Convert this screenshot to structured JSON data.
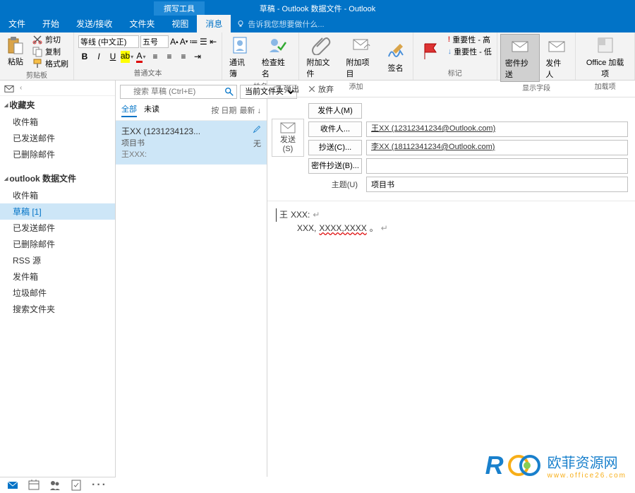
{
  "titlebar": {
    "tool": "撰写工具",
    "title": "草稿 - Outlook 数据文件 - Outlook"
  },
  "tabs": {
    "file": "文件",
    "home": "开始",
    "sendrecv": "发送/接收",
    "folder": "文件夹",
    "view": "视图",
    "message": "消息",
    "tellme": "告诉我您想要做什么..."
  },
  "ribbon": {
    "clipboard": {
      "label": "剪贴板",
      "paste": "粘贴",
      "cut": "剪切",
      "copy": "复制",
      "painter": "格式刷"
    },
    "font": {
      "label": "普通文本",
      "name": "等线 (中文正)",
      "size": "五号"
    },
    "names": {
      "label": "姓名",
      "addressbook": "通讯簿",
      "checknames": "检查姓名"
    },
    "include": {
      "label": "添加",
      "attachfile": "附加文件",
      "attachitem": "附加项目",
      "signature": "签名"
    },
    "tags": {
      "label": "标记",
      "imp_high": "重要性 - 高",
      "imp_low": "重要性 - 低",
      "followup": ""
    },
    "showfields": {
      "label": "显示字段",
      "bcc": "密件抄送",
      "from": "发件人"
    },
    "addins": {
      "label": "加载项",
      "office": "Office 加载项"
    }
  },
  "nav": {
    "favorites": "收藏夹",
    "fav_items": [
      "收件箱",
      "已发送邮件",
      "已删除邮件"
    ],
    "datafile": "outlook 数据文件",
    "df_items": [
      "收件箱",
      "草稿 [1]",
      "已发送邮件",
      "已删除邮件",
      "RSS 源",
      "发件箱",
      "垃圾邮件",
      "搜索文件夹"
    ]
  },
  "list": {
    "search_placeholder": "搜索 草稿 (Ctrl+E)",
    "scope": "当前文件夹",
    "all": "全部",
    "unread": "未读",
    "by_date": "按 日期",
    "newest": "最新 ↓",
    "item": {
      "from": "王XX (1231234123...",
      "subject": "项目书",
      "preview": "王XXX:",
      "date": "无"
    }
  },
  "read": {
    "popout": "弹出",
    "discard": "放弃",
    "from_label": "发件人(M)",
    "send": "发送",
    "send_key": "(S)",
    "to_btn": "收件人...",
    "to_val": "王XX (12312341234@Outlook.com)",
    "cc_btn": "抄送(C)...",
    "cc_val": "李XX (18112341234@Outlook.com)",
    "bcc_btn": "密件抄送(B)...",
    "bcc_val": "",
    "subject_label": "主题(U)",
    "subject_val": "项目书",
    "body_l1a": "王",
    "body_l1b": " XXX:",
    "body_l2a": "XXX,",
    "body_l2b": "XXXX,XXXX"
  },
  "watermark": {
    "main": "欧菲资源网",
    "sub": "www.office26.com"
  }
}
